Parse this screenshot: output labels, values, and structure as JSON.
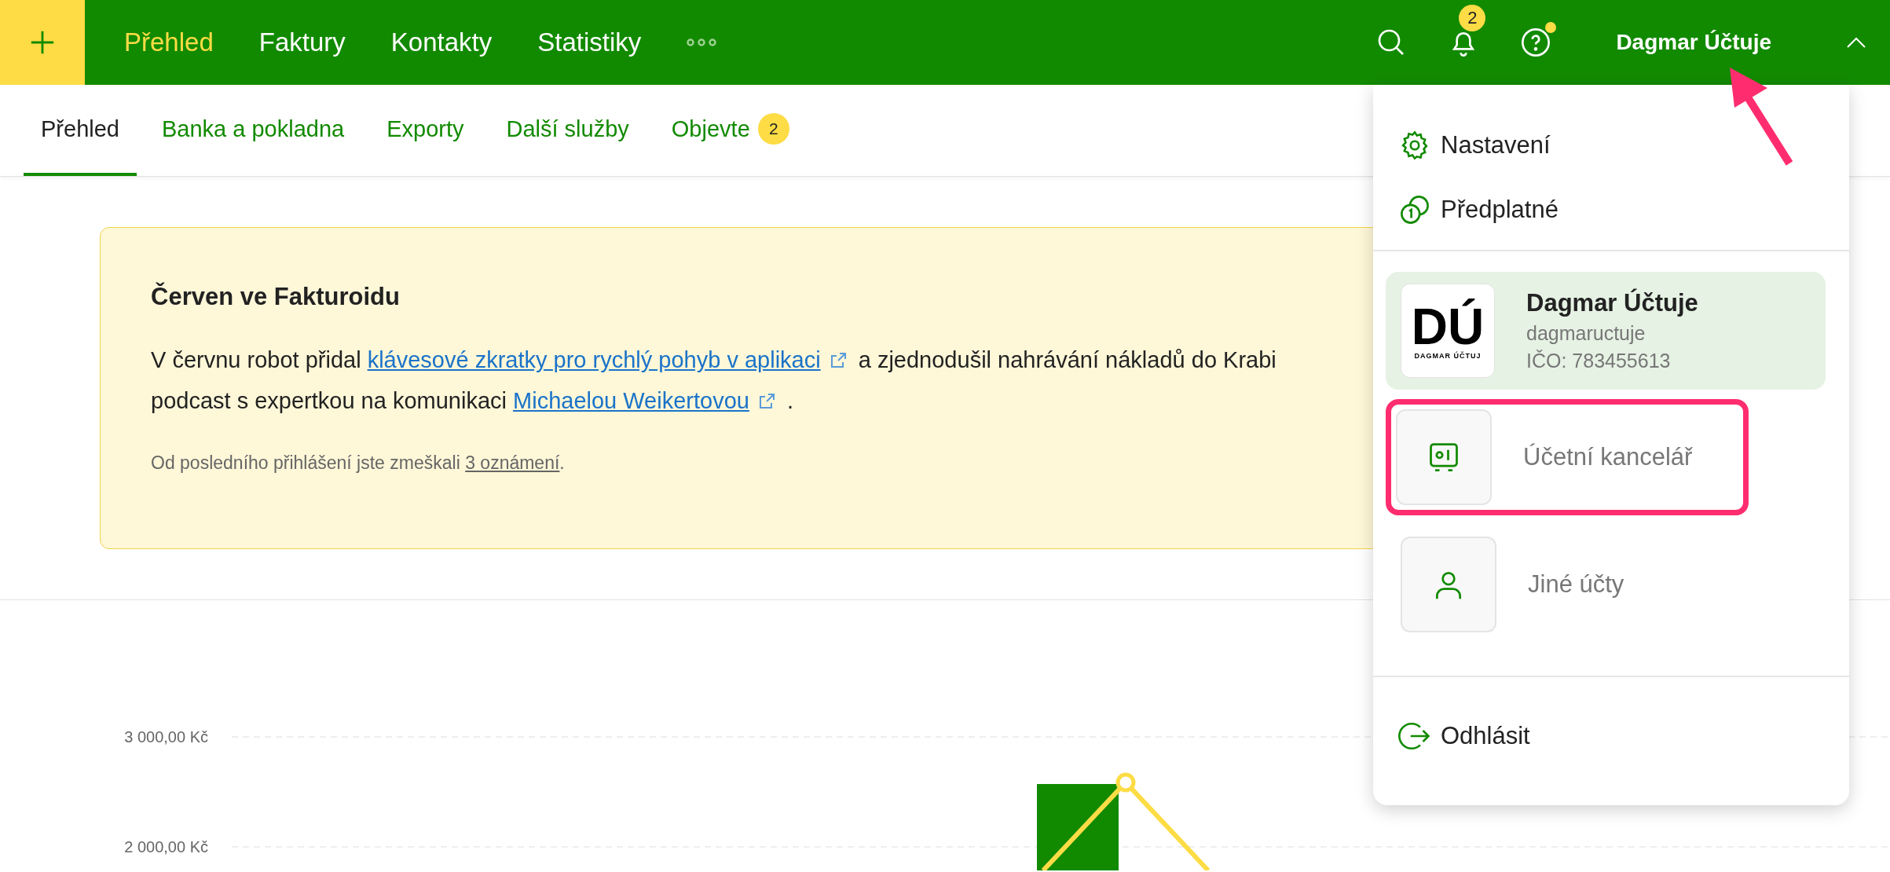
{
  "topbar": {
    "nav": [
      {
        "label": "Přehled",
        "selected": true
      },
      {
        "label": "Faktury",
        "selected": false
      },
      {
        "label": "Kontakty",
        "selected": false
      },
      {
        "label": "Statistiky",
        "selected": false
      }
    ],
    "notifications_badge": "2",
    "help_dot": true,
    "user": {
      "name": "Dagmar Účtuje",
      "expanded": true
    }
  },
  "subtabs": [
    {
      "label": "Přehled",
      "selected": true
    },
    {
      "label": "Banka a pokladna",
      "selected": false
    },
    {
      "label": "Exporty",
      "selected": false
    },
    {
      "label": "Další služby",
      "selected": false
    },
    {
      "label": "Objevte",
      "selected": false,
      "badge": "2"
    }
  ],
  "banner": {
    "title": "Červen ve Fakturoidu",
    "lines": [
      [
        {
          "text": "V červnu robot přidal "
        },
        {
          "text": "klávesové zkratky pro rychlý pohyb v aplikaci",
          "link": true
        },
        {
          "text": " a zjednodušil nahrávání nákladů do Krabi"
        }
      ],
      [
        {
          "text": "podcast s expertkou na komunikaci "
        },
        {
          "text": "Michaelou Weikertovou",
          "link": true
        },
        {
          "text": " ."
        }
      ]
    ],
    "footer": {
      "text": "Od posledního přihlášení jste zmeškali ",
      "link": "3 oznámení",
      "after": "."
    }
  },
  "chart": {
    "axis_labels": [
      "3 000,00 Kč",
      "2 000,00 Kč"
    ]
  },
  "dropdown": {
    "menu": [
      {
        "kind": "settings",
        "label": "Nastavení"
      },
      {
        "kind": "subscription",
        "label": "Předplatné"
      }
    ],
    "accounts": [
      {
        "kind": "company",
        "name": "Dagmar Účtuje",
        "username": "dagmaructuje",
        "ico": "IČO: 783455613",
        "logo": {
          "mark": "DÚ",
          "caption": "DAGMAR ÚČTUJ"
        },
        "selected": true,
        "highlighted": false
      },
      {
        "kind": "office",
        "name": "Účetní kancelář",
        "selected": false,
        "highlighted": true
      },
      {
        "kind": "person",
        "name": "Jiné účty",
        "selected": false,
        "highlighted": false
      }
    ],
    "logout": "Odhlásit"
  }
}
